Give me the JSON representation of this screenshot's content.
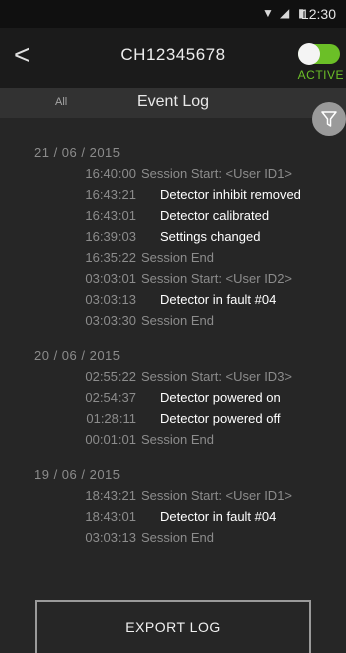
{
  "status": {
    "time": "12:30"
  },
  "header": {
    "back": "<",
    "title": "CH12345678",
    "toggle_label": "ACTIVE",
    "toggle_state": "on",
    "toggle_color": "#6bbf27"
  },
  "tabs": {
    "all": "All",
    "title": "Event Log"
  },
  "icons": {
    "filter": "filter-funnel-icon",
    "back": "back-chevron-icon"
  },
  "log": [
    {
      "date": "21 / 06 / 2015",
      "entries": [
        {
          "time": "16:40:00",
          "desc": "Session Start: <User ID1>",
          "highlight": false
        },
        {
          "time": "16:43:21",
          "desc": "Detector inhibit removed",
          "highlight": true
        },
        {
          "time": "16:43:01",
          "desc": "Detector calibrated",
          "highlight": true
        },
        {
          "time": "16:39:03",
          "desc": "Settings changed",
          "highlight": true
        },
        {
          "time": "16:35:22",
          "desc": "Session End",
          "highlight": false
        },
        {
          "time": "03:03:01",
          "desc": "Session Start: <User ID2>",
          "highlight": false
        },
        {
          "time": "03:03:13",
          "desc": "Detector in fault #04",
          "highlight": true
        },
        {
          "time": "03:03:30",
          "desc": "Session End",
          "highlight": false
        }
      ]
    },
    {
      "date": "20 / 06 / 2015",
      "entries": [
        {
          "time": "02:55:22",
          "desc": "Session Start: <User ID3>",
          "highlight": false
        },
        {
          "time": "02:54:37",
          "desc": "Detector powered on",
          "highlight": true
        },
        {
          "time": "01:28:11",
          "desc": "Detector powered off",
          "highlight": true
        },
        {
          "time": "00:01:01",
          "desc": "Session End",
          "highlight": false
        }
      ]
    },
    {
      "date": "19 / 06 / 2015",
      "entries": [
        {
          "time": "18:43:21",
          "desc": "Session Start: <User ID1>",
          "highlight": false
        },
        {
          "time": "18:43:01",
          "desc": "Detector in fault #04",
          "highlight": true
        },
        {
          "time": "03:03:13",
          "desc": "Session End",
          "highlight": false
        }
      ]
    }
  ],
  "export": {
    "label": "EXPORT LOG"
  }
}
